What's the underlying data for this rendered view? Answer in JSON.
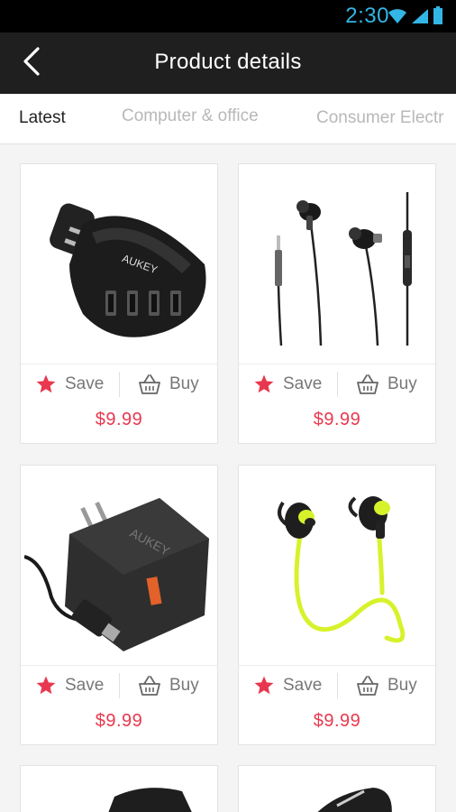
{
  "status_bar": {
    "time": "2:30"
  },
  "app_bar": {
    "title": "Product details"
  },
  "tabs": [
    {
      "label": "Latest",
      "active": true
    },
    {
      "label": "Computer & office",
      "active": false
    },
    {
      "label": "Consumer Electr",
      "active": false
    }
  ],
  "products": [
    {
      "name": "car-charger",
      "save_label": "Save",
      "buy_label": "Buy",
      "price": "$9.99",
      "brand": "AUKEY"
    },
    {
      "name": "wired-earphones",
      "save_label": "Save",
      "buy_label": "Buy",
      "price": "$9.99"
    },
    {
      "name": "wall-charger",
      "save_label": "Save",
      "buy_label": "Buy",
      "price": "$9.99",
      "brand": "AUKEY"
    },
    {
      "name": "bluetooth-sport-earphones",
      "save_label": "Save",
      "buy_label": "Buy",
      "price": "$9.99"
    }
  ],
  "colors": {
    "accent": "#e8384f",
    "appbar": "#1f1f1f",
    "status_icons": "#33b5e5",
    "earphone_cable": "#d7f22b"
  }
}
